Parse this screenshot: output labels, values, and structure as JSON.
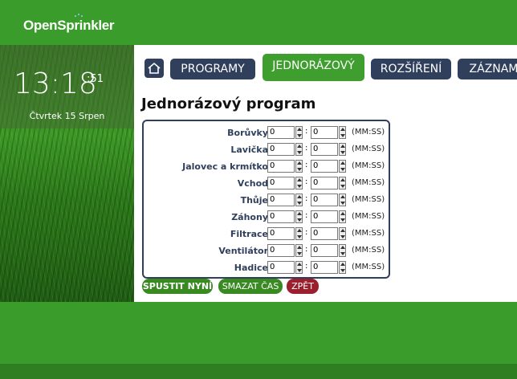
{
  "app": {
    "logo_text": "OpenSprinkler"
  },
  "sidebar": {
    "clock": "13:18",
    "seconds": ":51",
    "date": "Čtvrtek 15 Srpen"
  },
  "nav": {
    "home_icon": "home-icon",
    "tabs": [
      {
        "label": "PROGRAMY",
        "active": false
      },
      {
        "label": "JEDNORÁZOVÝ",
        "active": true
      },
      {
        "label": "ROZŠÍŘENÍ",
        "active": false
      },
      {
        "label": "ZÁZNAM",
        "active": false
      }
    ]
  },
  "page": {
    "title": "Jednorázový program"
  },
  "stations": [
    {
      "name": "Borůvky",
      "min": "0",
      "sec": "0",
      "unit": "(MM:SS)"
    },
    {
      "name": "Lavička",
      "min": "0",
      "sec": "0",
      "unit": "(MM:SS)"
    },
    {
      "name": "Jalovec a krmítko",
      "min": "0",
      "sec": "0",
      "unit": "(MM:SS)"
    },
    {
      "name": "Vchod",
      "min": "0",
      "sec": "0",
      "unit": "(MM:SS)"
    },
    {
      "name": "Thůje",
      "min": "0",
      "sec": "0",
      "unit": "(MM:SS)"
    },
    {
      "name": "Záhony",
      "min": "0",
      "sec": "0",
      "unit": "(MM:SS)"
    },
    {
      "name": "Filtrace",
      "min": "0",
      "sec": "0",
      "unit": "(MM:SS)"
    },
    {
      "name": "Ventilátor",
      "min": "0",
      "sec": "0",
      "unit": "(MM:SS)"
    },
    {
      "name": "Hadice",
      "min": "0",
      "sec": "0",
      "unit": "(MM:SS)"
    }
  ],
  "actions": {
    "run_label": "SPUSTIT NYNÍ",
    "clear_label": "SMAZAT ČAS",
    "back_label": "ZPĚT"
  },
  "colors": {
    "brand_green": "#3a9c2a",
    "navy": "#2f3f5c",
    "dark_green": "#2f7f22",
    "back_red": "#9c1f2e"
  }
}
